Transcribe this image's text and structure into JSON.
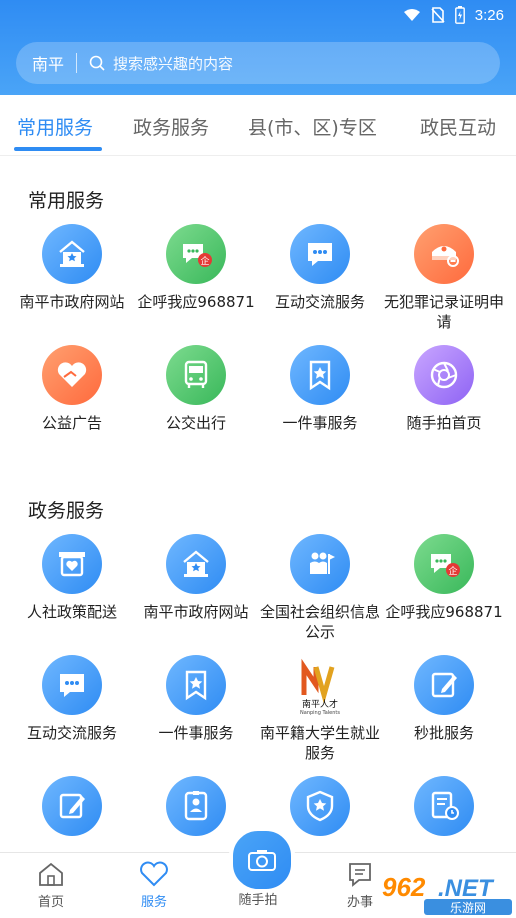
{
  "status_bar": {
    "time": "3:26"
  },
  "search": {
    "city": "南平",
    "placeholder": "搜索感兴趣的内容"
  },
  "tabs": [
    {
      "label": "常用服务",
      "active": true
    },
    {
      "label": "政务服务",
      "active": false
    },
    {
      "label": "县(市、区)专区",
      "active": false
    },
    {
      "label": "政民互动",
      "active": false
    }
  ],
  "sections": [
    {
      "title": "常用服务",
      "items": [
        {
          "label": "南平市政府网站",
          "icon": "government-house-icon",
          "color": "blue"
        },
        {
          "label": "企呼我应968871",
          "icon": "enterprise-chat-icon",
          "color": "green"
        },
        {
          "label": "互动交流服务",
          "icon": "chat-bubble-icon",
          "color": "blue"
        },
        {
          "label": "无犯罪记录证明申请",
          "icon": "police-cap-icon",
          "color": "orange"
        },
        {
          "label": "公益广告",
          "icon": "heart-hand-icon",
          "color": "orange"
        },
        {
          "label": "公交出行",
          "icon": "bus-icon",
          "color": "green"
        },
        {
          "label": "一件事服务",
          "icon": "star-bookmark-icon",
          "color": "blue"
        },
        {
          "label": "随手拍首页",
          "icon": "camera-aperture-icon",
          "color": "purple"
        }
      ]
    },
    {
      "title": "政务服务",
      "items": [
        {
          "label": "人社政策配送",
          "icon": "social-security-icon",
          "color": "blue"
        },
        {
          "label": "南平市政府网站",
          "icon": "government-house-icon",
          "color": "blue"
        },
        {
          "label": "全国社会组织信息公示",
          "icon": "people-flag-icon",
          "color": "blue"
        },
        {
          "label": "企呼我应968871",
          "icon": "enterprise-chat-icon",
          "color": "green"
        },
        {
          "label": "互动交流服务",
          "icon": "chat-bubble-icon",
          "color": "blue"
        },
        {
          "label": "一件事服务",
          "icon": "star-bookmark-icon",
          "color": "blue"
        },
        {
          "label": "南平籍大学生就业服务",
          "icon": "nanping-talent-logo",
          "color": "none",
          "logo_text": "南平人才",
          "logo_sub": "Nanping Talents"
        },
        {
          "label": "秒批服务",
          "icon": "edit-note-icon",
          "color": "blue"
        },
        {
          "label": "",
          "icon": "edit-note-icon",
          "color": "blue"
        },
        {
          "label": "",
          "icon": "id-card-icon",
          "color": "blue"
        },
        {
          "label": "",
          "icon": "shield-star-icon",
          "color": "blue"
        },
        {
          "label": "",
          "icon": "document-clock-icon",
          "color": "blue"
        }
      ]
    }
  ],
  "bottom_nav": [
    {
      "label": "首页",
      "icon": "home-icon"
    },
    {
      "label": "服务",
      "icon": "heart-icon",
      "active": true
    },
    {
      "label": "随手拍",
      "icon": "camera-icon"
    },
    {
      "label": "办事",
      "icon": "chat-doc-icon"
    }
  ],
  "watermark": {
    "text": "962.NET",
    "sub": "乐游网"
  },
  "colors": {
    "primary": "#2f8cf3",
    "green": "#39b85a",
    "orange": "#ff6a3d",
    "purple": "#8e63f4"
  }
}
